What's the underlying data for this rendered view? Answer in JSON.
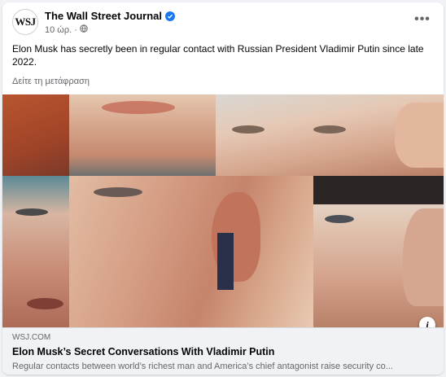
{
  "post": {
    "page_name": "The Wall Street Journal",
    "avatar_text": "WSJ",
    "time": "10 ώρ.",
    "separator": "·",
    "privacy_icon": "globe-icon",
    "more_label": "•••",
    "text": "Elon Musk has secretly been in regular contact with Russian President Vladimir Putin since late 2022.",
    "translate_label": "Δείτε τη μετάφραση"
  },
  "link_preview": {
    "domain": "WSJ.COM",
    "title": "Elon Musk’s Secret Conversations With Vladimir Putin",
    "description": "Regular contacts between world’s richest man and America’s chief antagonist raise security co...",
    "info_label": "i"
  },
  "colors": {
    "verified": "#1877f2",
    "secondary_text": "#65676b",
    "primary_text": "#050505"
  }
}
